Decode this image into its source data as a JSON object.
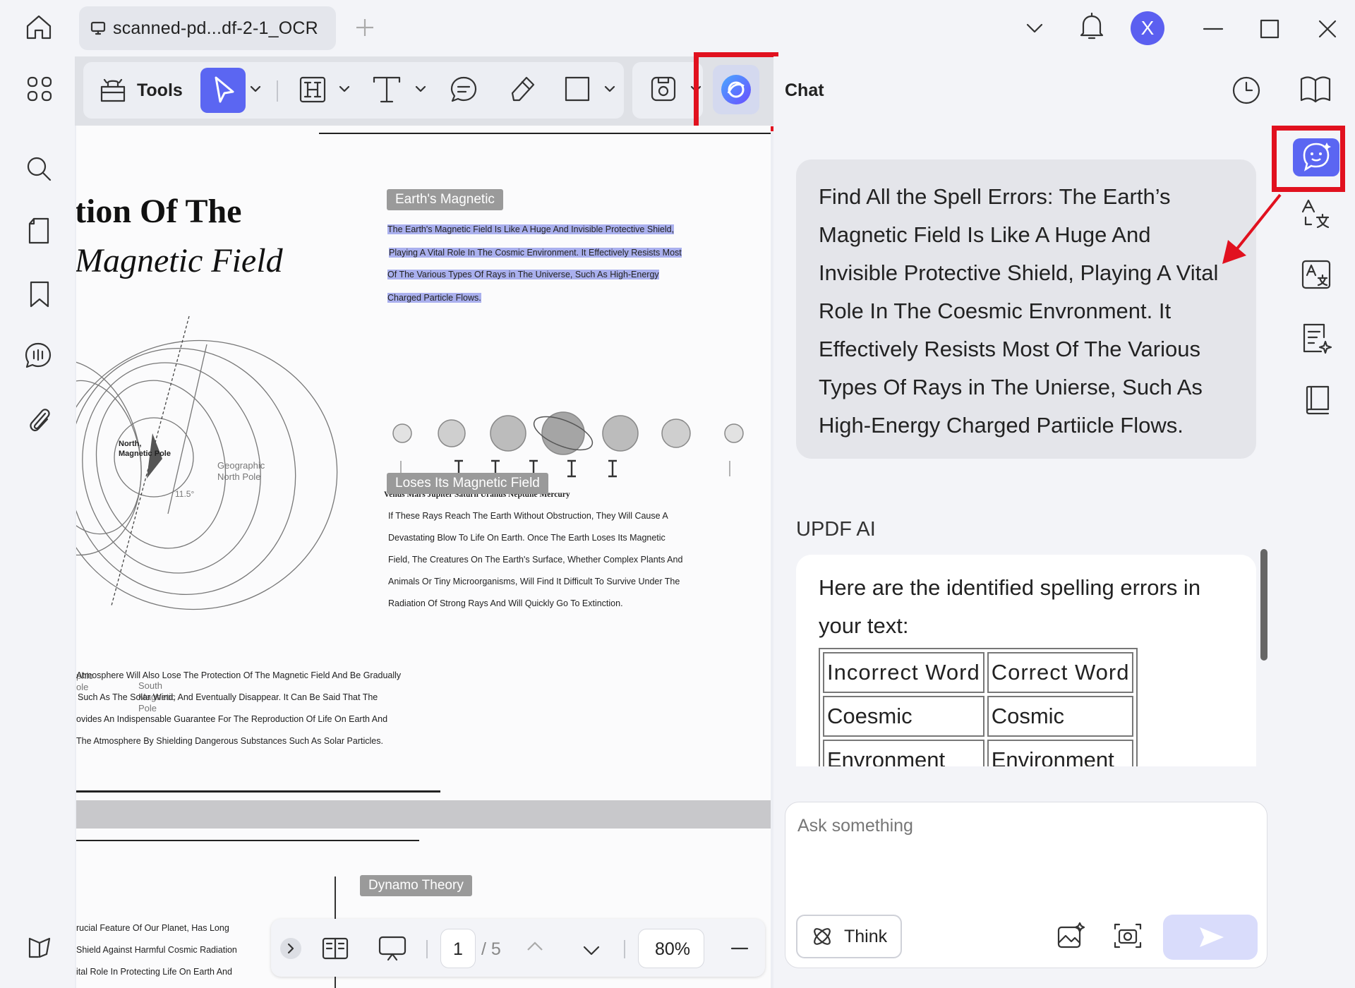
{
  "titlebar": {
    "tab_title": "scanned-pd...df-2-1_OCR",
    "avatar_letter": "X"
  },
  "toolbar": {
    "tools_label": "Tools"
  },
  "document": {
    "title_line1": "tion Of The",
    "title_line2": "Magnetic Field",
    "tag_earth": "Earth's Magnetic",
    "highlight_lines": [
      "The Earth's Magnetic Field Is Like A Huge And Invisible Protective Shield,",
      "Playing A Vital Role In The Cosmic Environment. It Effectively Resists Most",
      "Of The Various Types Of Rays in The Universe, Such As High-Energy",
      "Charged Particle Flows."
    ],
    "planets_caption": "Venus Mars Jupiter Saturn Uranus Neptune Mercury",
    "tag_loses": "Loses Its Magnetic Field",
    "loses_lines": [
      "If These Rays Reach The Earth Without Obstruction, They Will Cause A",
      "Devastating Blow To Life On Earth. Once The Earth Loses Its Magnetic",
      "Field, The Creatures On The Earth's Surface, Whether Complex Plants And",
      "Animals Or Tiny Microorganisms, Will Find It Difficult To Survive Under The",
      "Radiation Of Strong Rays And Will Quickly Go To Extinction."
    ],
    "atmos_lines": [
      "Atmosphere Will Also Lose The Protection Of The Magnetic Field And Be Gradually",
      "Such As The Solar Wind, And Eventually Disappear. It Can Be Said That The",
      "ovides An Indispensable Guarantee For The Reproduction Of Life On Earth And",
      "The Atmosphere By Shielding Dangerous Substances Such As Solar Particles."
    ],
    "diagram_labels": {
      "north": "North,",
      "north2": "Magnetic Pole",
      "geo_north": "Geographic",
      "geo_north2": "North Pole",
      "angle": "11.5°",
      "south": "South",
      "south2": "Magnetic",
      "south3": "Pole",
      "geo_south": "phic",
      "geo_south2": "ole"
    },
    "tag_dynamo": "Dynamo Theory",
    "bottom_lines": [
      "rucial Feature Of Our Planet, Has Long",
      "Shield Against Harmful Cosmic Radiation",
      "ital Role In Protecting Life On Earth And"
    ]
  },
  "doc_nav": {
    "current_page": "1",
    "total_pages": "/ 5",
    "zoom": "80%"
  },
  "chat": {
    "title": "Chat",
    "user_message": "Find All the Spell Errors: The Earth’s Magnetic Field Is Like A Huge And Invisible Protective Shield, Playing A Vital Role In The Coesmic Envronment. It Effectively Resists Most Of The Various Types Of Rays in The Unierse, Such As High-Energy Charged Partiicle Flows.",
    "ai_label": "UPDF AI",
    "ai_intro": "Here are the identified spelling errors in your text:",
    "table_headers": [
      "Incorrect Word",
      "Correct Word"
    ],
    "table_rows": [
      [
        "Coesmic",
        "Cosmic"
      ],
      [
        "Envronment",
        "Environment"
      ]
    ],
    "input_placeholder": "Ask something",
    "think_label": "Think"
  },
  "colors": {
    "accent": "#5b66f2",
    "highlight_red": "#e1111f"
  }
}
